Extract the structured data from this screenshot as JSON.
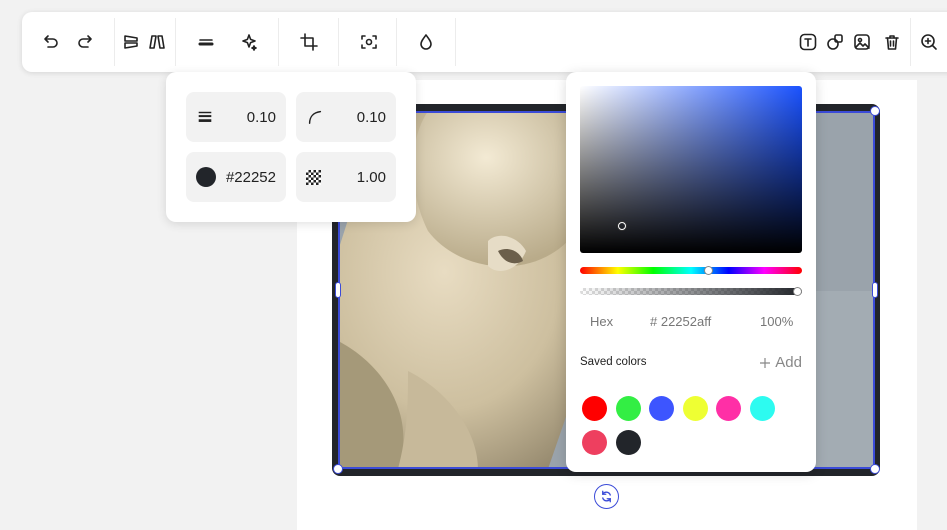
{
  "toolbar": {
    "left_icons": [
      "undo-icon",
      "redo-icon",
      "flip-vertical-icon",
      "flip-horizontal-icon",
      "stroke-width-icon",
      "magic-sparkle-icon",
      "crop-icon",
      "focus-scan-icon",
      "drop-icon"
    ],
    "right_icons": [
      "text-icon",
      "shapes-icon",
      "image-icon",
      "trash-icon",
      "zoom-in-icon"
    ]
  },
  "stroke_panel": {
    "width_value": "0.10",
    "radius_value": "0.10",
    "color_value": "#22252",
    "opacity_value": "1.00",
    "color_swatch": "#22252a"
  },
  "color_picker": {
    "hex_label": "Hex",
    "hex_value": "# 22252aff",
    "alpha_percent": "100%",
    "saved_label": "Saved colors",
    "add_label": "Add",
    "hue_position": 0.58,
    "alpha_position": 1.0,
    "saturation_position": 0.19,
    "brightness_position": 0.16,
    "saved_colors": [
      "#ff0000",
      "#33ee44",
      "#3d55ff",
      "#eeff33",
      "#ff2fa6",
      "#2dfbf0",
      "#ee3f5f",
      "#22252a"
    ]
  },
  "selection_color": "#3b4bd8"
}
